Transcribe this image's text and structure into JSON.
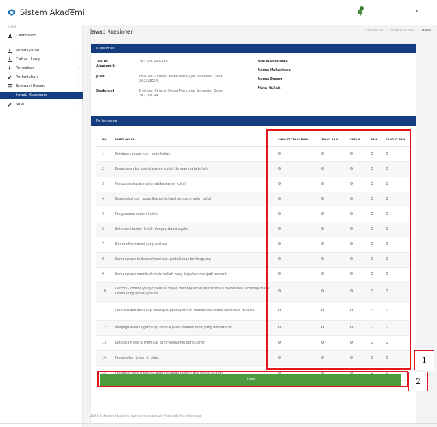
{
  "app": {
    "title": "Sistem Akademi"
  },
  "sidebar": {
    "section": "HOME",
    "items": [
      {
        "label": "Dashboard",
        "icon": "bar-chart-icon"
      },
      {
        "label": "Pembayaran",
        "icon": "download-icon",
        "caret": "›"
      },
      {
        "label": "Daftar Ulang",
        "icon": "download-icon",
        "caret": "›"
      },
      {
        "label": "Perwalian",
        "icon": "download-icon",
        "caret": "›"
      },
      {
        "label": "Perkuliahan",
        "icon": "pencil-icon",
        "caret": "›"
      },
      {
        "label": "Evaluasi Dosen",
        "icon": "list-icon",
        "caret": "›"
      },
      {
        "label": "SKPI",
        "icon": "pencil-icon",
        "caret": "›"
      }
    ],
    "active_sub": "Jawab Kuesioner"
  },
  "header": {
    "page_title": "Jawab Kuesioner",
    "breadcrumb": [
      "Dashboard",
      "›",
      "Jawab Kuesioner",
      "›",
      "Detail"
    ]
  },
  "kuesioner": {
    "title": "Kuesioner",
    "tahun_label": "Tahun Akademik",
    "tahun_value": "2023/2024 Gasal",
    "judul_label": "Judul",
    "judul_value": "Evaluasi Kinerja Dosen Mengajar Semester Gasal 2023/2024",
    "deskripsi_label": "Deskripsi",
    "deskripsi_value": "Evaluasi Kinerja Dosen Mengajar Semester Gasal 2023/2024",
    "right_labels": [
      "NIM Mahasiswa",
      "Nama Mahasiswa",
      "Nama Dosen",
      "Mata Kuliah"
    ]
  },
  "pertanyaan": {
    "title": "Pertanyaan",
    "columns": [
      "NO.",
      "PERTANYAAN",
      "SANGAT TIDAK BAIK",
      "TIDAK BAIK",
      "CUKUP",
      "BAIK",
      "SANGAT BAIK"
    ],
    "rows": [
      {
        "no": "1",
        "q": "Kejelasan tujuan dari mata kuliah"
      },
      {
        "no": "2",
        "q": "Kesesuaian komposisi materi kuliah dengan mata kuliah"
      },
      {
        "no": "3",
        "q": "Pengorganisasian sistematika materi kuliah"
      },
      {
        "no": "4",
        "q": "Kesetimbangan tugas (kasus/latihan) dengan materi kuliah"
      },
      {
        "no": "5",
        "q": "Penguasaan materi kuliah"
      },
      {
        "no": "6",
        "q": "Relevansi materi kuliah dengan dunia nyata"
      },
      {
        "no": "7",
        "q": "Handout/referensi yang berikan"
      },
      {
        "no": "8",
        "q": "Kemampuan berkomunikasi saat perkuliahan berlangsung"
      },
      {
        "no": "9",
        "q": "Kemampuan membuat mata kuliah yang diajarkan menjadi menarik"
      },
      {
        "no": "10",
        "q": "Contoh - contoh yang diberikan dapat meningkatkan pemahaman mahasiswa terhadap mata kuliah yang bersangkutan"
      },
      {
        "no": "11",
        "q": "Keterbukaan terhadap pendapat-pendapat dari mahasiswa ketika berdiskusi di kelas"
      },
      {
        "no": "12",
        "q": "Menjaga kuliah agar tetap berada pada konteks topic yang dibicarakan"
      },
      {
        "no": "13",
        "q": "Ketepatan waktu memulai dan mengakhiri perkuliahan"
      },
      {
        "no": "14",
        "q": "Penampilan dosen di kelas"
      },
      {
        "no": "15",
        "q": "Penilaian secara keseluruhan terhadap dosen yang bersangkutan"
      }
    ]
  },
  "submit_label": "Kirim",
  "markers": [
    "1",
    "2"
  ],
  "footer": "2023 © Sistem Akademik dan Kemahasiswaan Politeknik Pos Indonesia"
}
